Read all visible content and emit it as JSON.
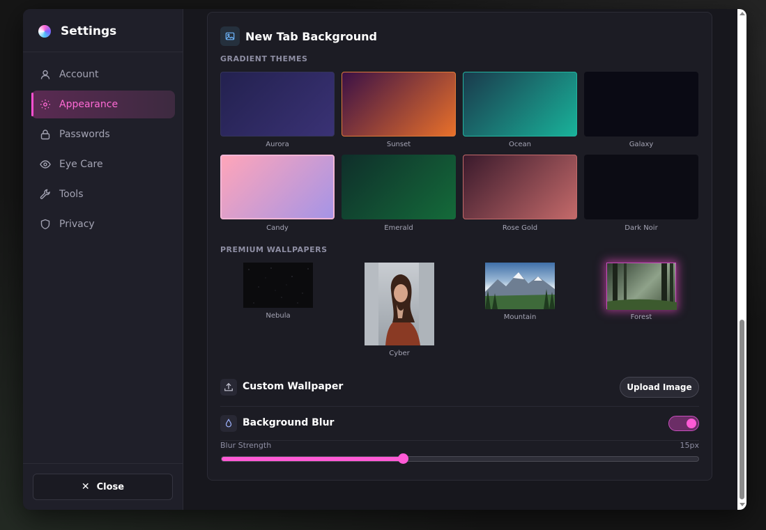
{
  "app": {
    "title": "Settings"
  },
  "sidebar": {
    "items": [
      {
        "label": "Account",
        "icon": "user-icon",
        "active": false
      },
      {
        "label": "Appearance",
        "icon": "sun-icon",
        "active": true
      },
      {
        "label": "Passwords",
        "icon": "lock-icon",
        "active": false
      },
      {
        "label": "Eye Care",
        "icon": "eye-icon",
        "active": false
      },
      {
        "label": "Tools",
        "icon": "wrench-icon",
        "active": false
      },
      {
        "label": "Privacy",
        "icon": "shield-icon",
        "active": false
      }
    ],
    "close_label": "Close"
  },
  "panel": {
    "title": "New Tab Background",
    "gradient_label": "GRADIENT THEMES",
    "gradients": [
      {
        "name": "Aurora",
        "colors": [
          "#23214f",
          "#3a3275"
        ]
      },
      {
        "name": "Sunset",
        "colors": [
          "#3b1146",
          "#e8702a"
        ]
      },
      {
        "name": "Ocean",
        "colors": [
          "#1a3a4c",
          "#19b29a"
        ]
      },
      {
        "name": "Galaxy",
        "colors": [
          "#0a0a14",
          "#0a0a14"
        ]
      },
      {
        "name": "Candy",
        "colors": [
          "#ffa5b9",
          "#a594e6"
        ]
      },
      {
        "name": "Emerald",
        "colors": [
          "#0f2e2a",
          "#146b3a"
        ]
      },
      {
        "name": "Rose Gold",
        "colors": [
          "#3a1a2c",
          "#c46a6a"
        ]
      },
      {
        "name": "Dark Noir",
        "colors": [
          "#0c0c14",
          "#0c0c14"
        ]
      }
    ],
    "premium_label": "PREMIUM WALLPAPERS",
    "wallpapers": [
      {
        "name": "Nebula"
      },
      {
        "name": "Cyber"
      },
      {
        "name": "Mountain"
      },
      {
        "name": "Forest"
      }
    ],
    "custom_label": "Custom Wallpaper",
    "upload_label": "Upload Image",
    "blur_label": "Background Blur",
    "blur_enabled": true,
    "strength_label": "Blur Strength",
    "strength_value": "15px",
    "strength_fraction": 0.38,
    "accent": "#ff5ad6"
  }
}
